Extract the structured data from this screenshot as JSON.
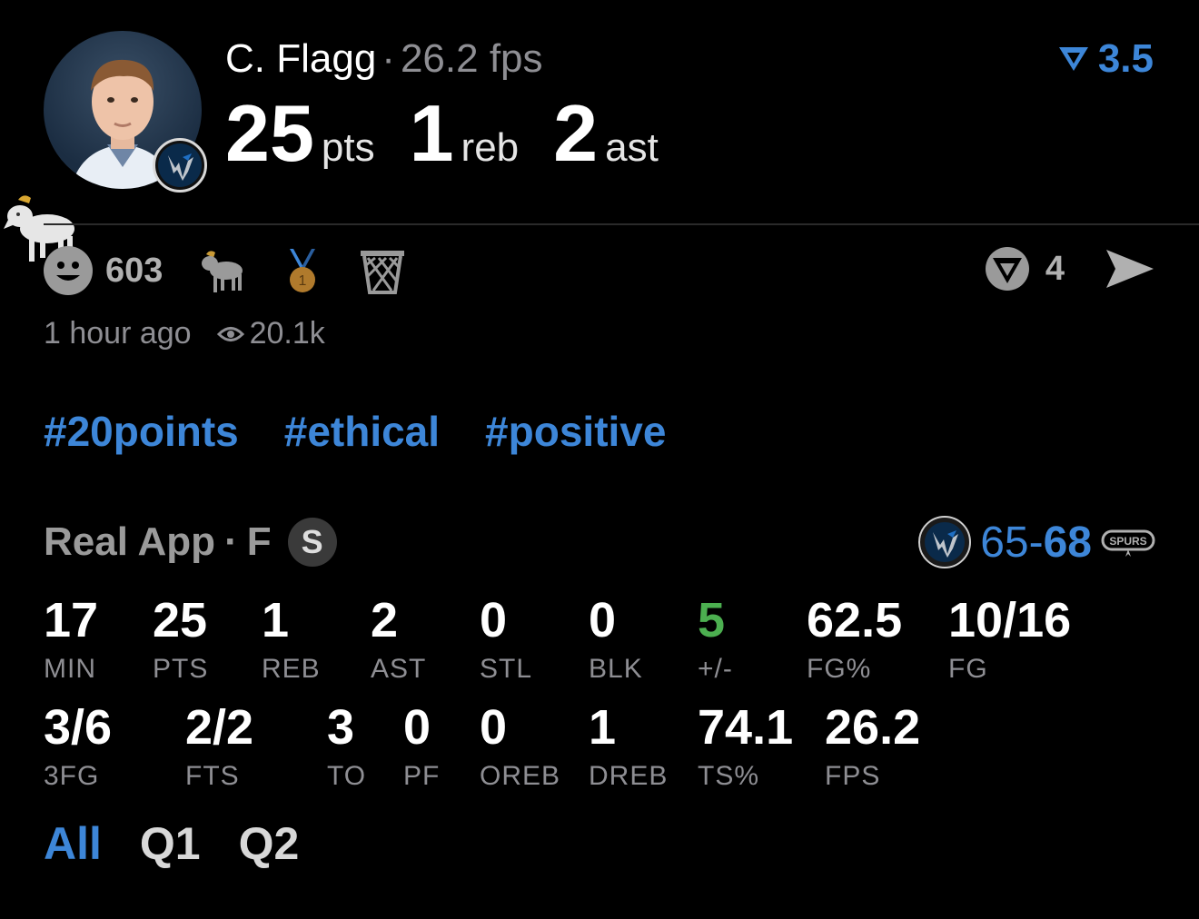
{
  "player": {
    "name": "C. Flagg",
    "separator": "·",
    "fps_label": "26.2 fps",
    "stats": [
      {
        "value": "25",
        "unit": "pts"
      },
      {
        "value": "1",
        "unit": "reb"
      },
      {
        "value": "2",
        "unit": "ast"
      }
    ],
    "avatar_icon": "player-photo",
    "team_icon": "mavericks-logo"
  },
  "top_score": {
    "icon": "filter-triangle-icon",
    "value": "3.5"
  },
  "reactions": {
    "count": "603",
    "icons": [
      "smile-icon",
      "goat-icon",
      "medal-icon",
      "basket-icon"
    ]
  },
  "share": {
    "icon": "triangle-badge-icon",
    "count": "4",
    "send_icon": "send-icon"
  },
  "meta": {
    "time": "1 hour ago",
    "views": "20.1k"
  },
  "hashtags": [
    "#20points",
    "#ethical",
    "#positive"
  ],
  "game": {
    "league": "Real App",
    "dot": "·",
    "position": "F",
    "badge": "S",
    "score_left": "65",
    "score_dash": "-",
    "score_right": "68",
    "spurs_text": "SPURS"
  },
  "stat_rows": [
    [
      {
        "value": "17",
        "label": "MIN"
      },
      {
        "value": "25",
        "label": "PTS"
      },
      {
        "value": "1",
        "label": "REB"
      },
      {
        "value": "2",
        "label": "AST"
      },
      {
        "value": "0",
        "label": "STL"
      },
      {
        "value": "0",
        "label": "BLK"
      },
      {
        "value": "5",
        "label": "+/-",
        "color": "#4caf50"
      },
      {
        "value": "62.5",
        "label": "FG%"
      },
      {
        "value": "10/16",
        "label": "FG"
      }
    ],
    [
      {
        "value": "3/6",
        "label": "3FG"
      },
      {
        "value": "2/2",
        "label": "FTS"
      },
      {
        "value": "3",
        "label": "TO"
      },
      {
        "value": "0",
        "label": "PF"
      },
      {
        "value": "0",
        "label": "OREB"
      },
      {
        "value": "1",
        "label": "DREB"
      },
      {
        "value": "74.1",
        "label": "TS%"
      },
      {
        "value": "26.2",
        "label": "FPS"
      }
    ]
  ],
  "tabs": [
    {
      "label": "All",
      "active": true
    },
    {
      "label": "Q1",
      "active": false
    },
    {
      "label": "Q2",
      "active": false
    }
  ],
  "colors": {
    "accent": "#3d86d8",
    "positive": "#4caf50",
    "muted": "#8e8e93",
    "background": "#000000"
  }
}
